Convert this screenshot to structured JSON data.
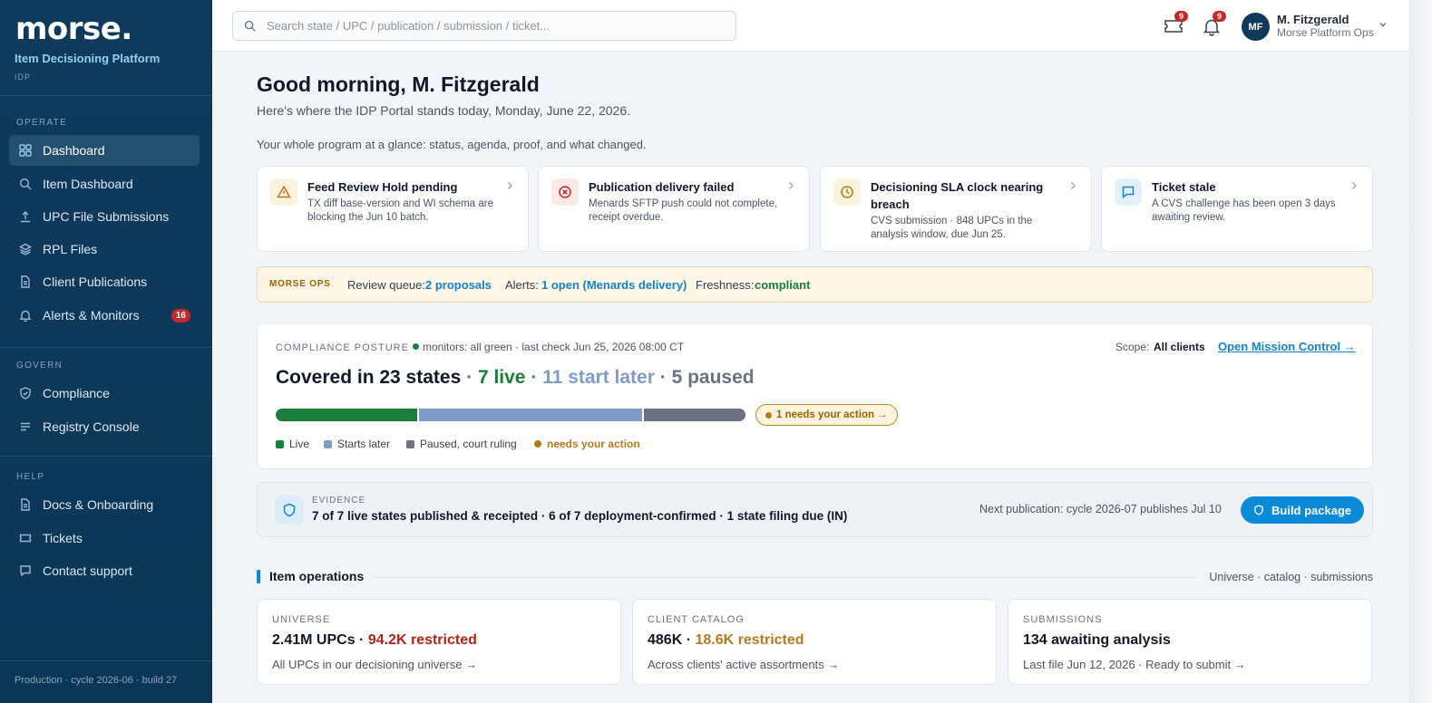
{
  "sidebar": {
    "logo": "morse.",
    "platform": "Item Decisioning Platform",
    "platform_short": "IDP",
    "sections": {
      "operate": "OPERATE",
      "govern": "GOVERN",
      "help": "HELP"
    },
    "items": [
      {
        "label": "Dashboard",
        "icon": "grid-icon"
      },
      {
        "label": "Item Dashboard",
        "icon": "search-icon"
      },
      {
        "label": "UPC File Submissions",
        "icon": "upload-icon"
      },
      {
        "label": "RPL Files",
        "icon": "layers-icon"
      },
      {
        "label": "Client Publications",
        "icon": "document-icon"
      },
      {
        "label": "Alerts & Monitors",
        "icon": "bell-icon",
        "badge": "16"
      },
      {
        "label": "Compliance",
        "icon": "shield-check-icon"
      },
      {
        "label": "Registry Console",
        "icon": "list-icon"
      },
      {
        "label": "Docs & Onboarding",
        "icon": "document-icon"
      },
      {
        "label": "Tickets",
        "icon": "ticket-icon"
      },
      {
        "label": "Contact support",
        "icon": "chat-icon"
      }
    ],
    "footer": "Production · cycle 2026-06 · build 27"
  },
  "topbar": {
    "search_placeholder": "Search state / UPC / publication / submission / ticket...",
    "tickets_count": "9",
    "notifications_count": "9",
    "user_initials": "MF",
    "user_name": "M. Fitzgerald",
    "user_org": "Morse Platform Ops"
  },
  "header": {
    "greeting": "Good morning, M. Fitzgerald",
    "subtitle": "Here's where the IDP Portal stands today, Monday, June 22, 2026.",
    "tagline": "Your whole program at a glance: status, agenda, proof, and what changed."
  },
  "alerts": [
    {
      "title": "Feed Review Hold pending",
      "desc": "TX diff base-version and WI schema are blocking the Jun 10 batch.",
      "icon": "warning-icon",
      "color": "#b7791f",
      "bg": "#fdf3dc"
    },
    {
      "title": "Publication delivery failed",
      "desc": "Menards SFTP push could not complete, receipt overdue.",
      "icon": "error-circle-icon",
      "color": "#c62828",
      "bg": "#fde8e8"
    },
    {
      "title": "Decisioning SLA clock nearing breach",
      "desc": "CVS submission · 848 UPCs in the analysis window, due Jun 25.",
      "icon": "clock-icon",
      "color": "#b7791f",
      "bg": "#fdf3dc"
    },
    {
      "title": "Ticket stale",
      "desc": "A CVS challenge has been open 3 days awaiting review.",
      "icon": "chat-icon",
      "color": "#1483d0",
      "bg": "#e3f1fb"
    }
  ],
  "ops": {
    "tag": "MORSE OPS",
    "review_label": "Review queue:",
    "review_value": "2 proposals",
    "alerts_label": "Alerts:",
    "alerts_value": "1 open (Menards delivery)",
    "freshness_label": "Freshness:",
    "freshness_value": "compliant"
  },
  "compliance": {
    "label": "COMPLIANCE POSTURE",
    "monitor": "monitors: all green · last check Jun 25, 2026 08:00 CT",
    "scope_label": "Scope:",
    "scope_value": "All clients",
    "mission_link": "Open Mission Control →",
    "headline": "Covered in 23 states",
    "live": "7 live",
    "later": "11 start later",
    "paused": "5 paused",
    "sep": " · ",
    "segments": [
      {
        "name": "live",
        "value": 7,
        "color": "#1a7f3c"
      },
      {
        "name": "later",
        "value": 11,
        "color": "#7f9cc9"
      },
      {
        "name": "paused",
        "value": 5,
        "color": "#6b7280"
      }
    ],
    "action_pill": "1 needs your action →",
    "legend": {
      "live": "Live",
      "later": "Starts later",
      "paused": "Paused, court ruling",
      "action": "needs your action"
    }
  },
  "evidence": {
    "label": "EVIDENCE",
    "text": "7 of 7 live states published & receipted · 6 of 7 deployment-confirmed · 1 state filing due (IN)",
    "next": "Next publication: cycle 2026-07 publishes Jul 10",
    "button": "Build package"
  },
  "operations": {
    "title": "Item operations",
    "meta": "Universe · catalog · submissions",
    "cards": [
      {
        "label": "UNIVERSE",
        "value": "2.41M UPCs",
        "extra": "94.2K restricted",
        "extra_color": "#b42318",
        "desc": "All UPCs in our decisioning universe →"
      },
      {
        "label": "CLIENT CATALOG",
        "value": "486K",
        "extra": "18.6K restricted",
        "extra_color": "#b7791f",
        "desc": "Across clients' active assortments →"
      },
      {
        "label": "SUBMISSIONS",
        "value": "134 awaiting analysis",
        "extra": "",
        "extra_color": "#111827",
        "desc": "Last file Jun 12, 2026 · Ready to submit →"
      }
    ]
  }
}
